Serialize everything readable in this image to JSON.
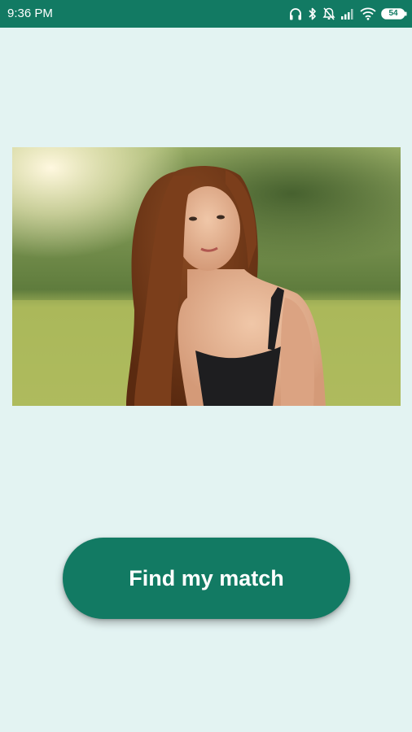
{
  "status_bar": {
    "time": "9:36 PM",
    "battery_level": "54",
    "icons": [
      "headphones-icon",
      "bluetooth-icon",
      "notifications-off-icon",
      "signal-icon",
      "wifi-icon",
      "battery-icon"
    ],
    "background_color": "#127a63"
  },
  "main": {
    "image_description_icon": "portrait-photo",
    "button_label": "Find my match",
    "accent_color": "#127a63",
    "background_color": "#e3f3f2"
  }
}
